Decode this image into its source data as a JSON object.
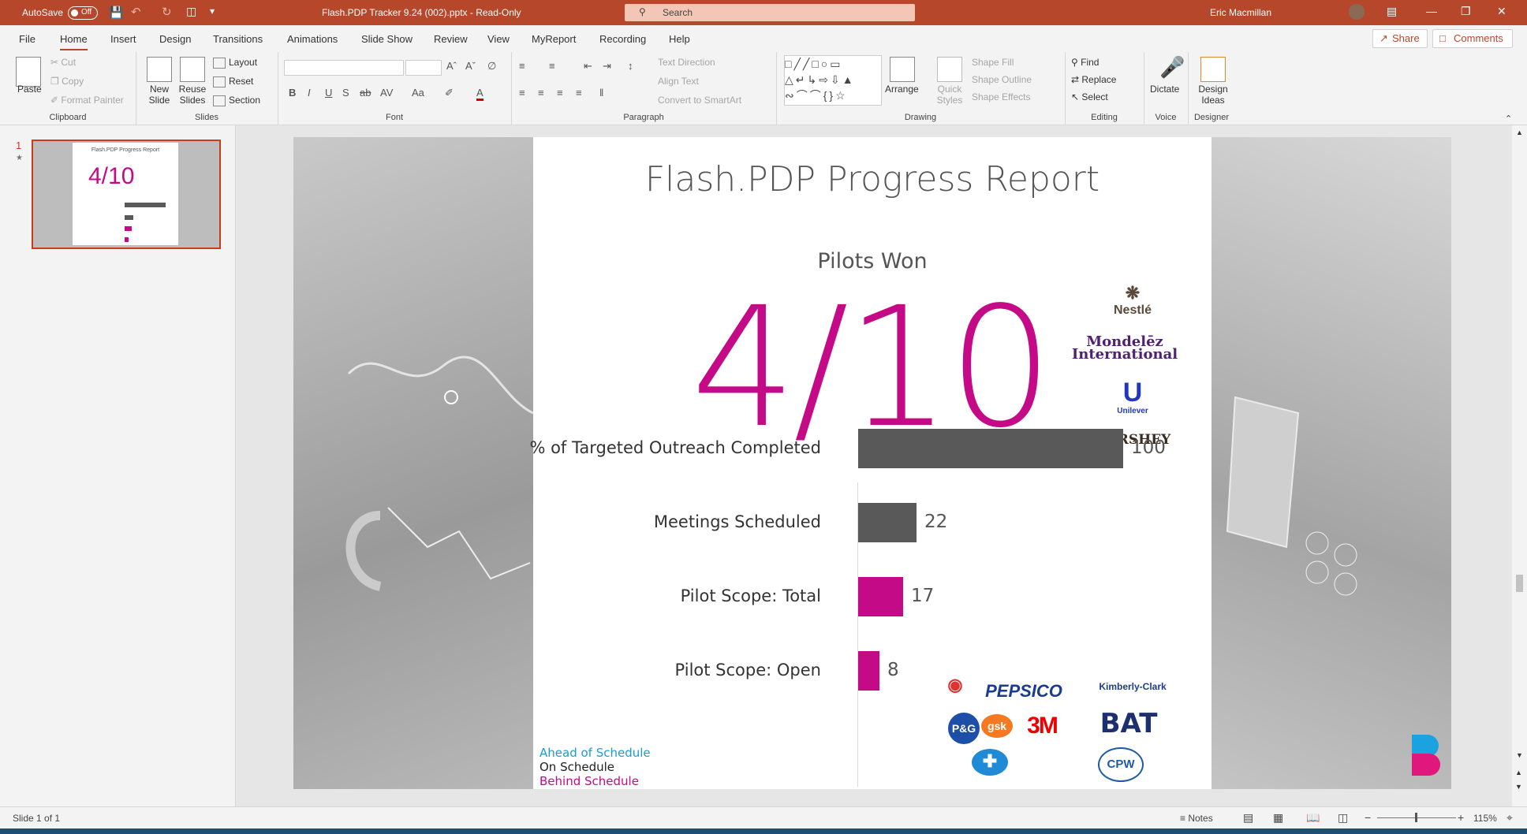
{
  "titlebar": {
    "autosave_label": "AutoSave",
    "autosave_state": "Off",
    "file_title": "Flash.PDP Tracker 9.24 (002).pptx - Read-Only",
    "search_placeholder": "Search",
    "user_name": "Eric Macmillan"
  },
  "menu": {
    "items": [
      "File",
      "Home",
      "Insert",
      "Design",
      "Transitions",
      "Animations",
      "Slide Show",
      "Review",
      "View",
      "MyReport",
      "Recording",
      "Help"
    ],
    "active": "Home",
    "share_label": "Share",
    "comments_label": "Comments"
  },
  "ribbon": {
    "clipboard": {
      "label": "Clipboard",
      "paste": "Paste",
      "cut": "Cut",
      "copy": "Copy",
      "format_painter": "Format Painter"
    },
    "slides": {
      "label": "Slides",
      "new_slide": "New Slide",
      "reuse_slides": "Reuse Slides",
      "layout": "Layout",
      "reset": "Reset",
      "section": "Section"
    },
    "font": {
      "label": "Font"
    },
    "paragraph": {
      "label": "Paragraph",
      "text_direction": "Text Direction",
      "align_text": "Align Text",
      "convert_smartart": "Convert to SmartArt"
    },
    "drawing": {
      "label": "Drawing",
      "arrange": "Arrange",
      "quick_styles": "Quick Styles",
      "shape_fill": "Shape Fill",
      "shape_outline": "Shape Outline",
      "shape_effects": "Shape Effects"
    },
    "editing": {
      "label": "Editing",
      "find": "Find",
      "replace": "Replace",
      "select": "Select"
    },
    "voice": {
      "label": "Voice",
      "dictate": "Dictate"
    },
    "designer": {
      "label": "Designer",
      "design_ideas": "Design Ideas"
    }
  },
  "thumbnail": {
    "number": "1",
    "star": "★",
    "title": "Flash.PDP Progress Report",
    "value": "4/10"
  },
  "slide": {
    "title": "Flash.PDP Progress Report",
    "pilots_label": "Pilots Won",
    "pilots_value": "4/10",
    "won_logos": [
      "Nestlé",
      "Mondelēz International",
      "Unilever",
      "HERSHEY"
    ],
    "prospect_logos": [
      "PEPSICO",
      "Kimberly-Clark",
      "P&G",
      "gsk",
      "3M",
      "BAT",
      "CPW"
    ],
    "legend": [
      {
        "text": "Ahead of Schedule",
        "color": "#1a9bd7"
      },
      {
        "text": "On Schedule",
        "color": "#222222"
      },
      {
        "text": "Behind Schedule",
        "color": "#c40a86"
      }
    ]
  },
  "chart_data": {
    "type": "bar",
    "orientation": "horizontal",
    "categories": [
      "% of Targeted Outreach Completed",
      "Meetings Scheduled",
      "Pilot Scope: Total",
      "Pilot Scope: Open"
    ],
    "values": [
      100,
      22,
      17,
      8
    ],
    "colors": [
      "#595959",
      "#595959",
      "#c40a86",
      "#c40a86"
    ],
    "xlim": [
      0,
      100
    ],
    "data_labels": [
      "100",
      "22",
      "17",
      "8"
    ]
  },
  "statusbar": {
    "slide_info": "Slide 1 of 1",
    "notes": "Notes",
    "zoom": "115%"
  }
}
